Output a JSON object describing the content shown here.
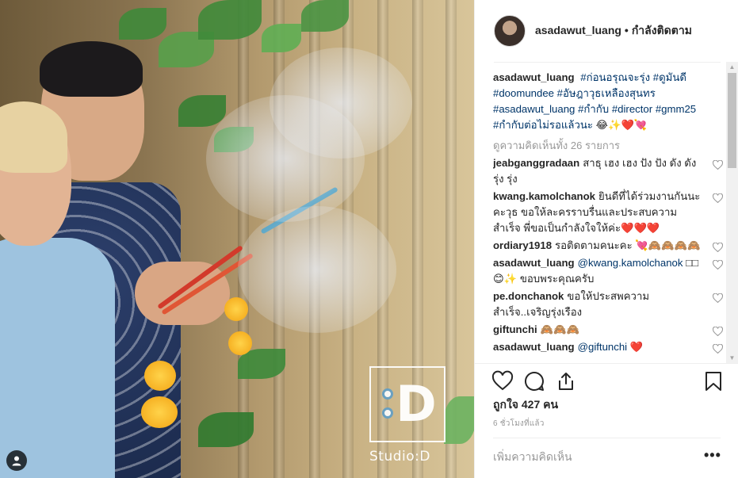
{
  "post": {
    "watermark_text": "Studio:D",
    "watermark_letter": "D"
  },
  "header": {
    "username": "asadawut_luang",
    "separator": "•",
    "follow_label": "กำลังติดตาม"
  },
  "caption": {
    "username": "asadawut_luang",
    "hashtags": [
      "#ก่อนอรุณจะรุ่ง",
      "#ดูมันดี",
      "#doomundee",
      "#อัษฎาวุธเหลืองสุนทร",
      "#asadawut_luang",
      "#กำกับ",
      "#director",
      "#gmm25",
      "#กำกับต่อไม่รอแล้วนะ"
    ],
    "emoji_tail": "😂✨❤️💘"
  },
  "view_all_comments": "ดูความคิดเห็นทั้ง 26 รายการ",
  "comments": [
    {
      "user": "jeabganggradaan",
      "text": "สาธุ เฮง เฮง ปัง ปัง ดัง ดัง รุ่ง รุ่ง"
    },
    {
      "user": "kwang.kamolchanok",
      "text": "ยินดีที่ได้ร่วมงานกันนะคะวุธ ขอให้ละครราบรื่นและประสบความสำเร็จ พี่ขอเป็นกำลังใจให้ค่ะ❤️❤️❤️"
    },
    {
      "user": "ordiary1918",
      "text": "รอติดตามคนะคะ 💘🙈🙈🙈🙈"
    },
    {
      "user": "asadawut_luang",
      "mention": "@kwang.kamolchanok",
      "text": "□□😊✨ ขอบพระคุณครับ"
    },
    {
      "user": "pe.donchanok",
      "text": "ขอให้ประสพความสำเร็จ..เจริญรุ่งเรือง"
    },
    {
      "user": "giftunchi",
      "text": "🙈🙈🙈"
    },
    {
      "user": "asadawut_luang",
      "mention": "@giftunchi",
      "text": "❤️"
    }
  ],
  "actions": {
    "like_icon": "heart-outline",
    "comment_icon": "speech-bubble",
    "share_icon": "share-arrow",
    "save_icon": "bookmark"
  },
  "likes_text": "ถูกใจ 427 คน",
  "timestamp": "6 ชั่วโมงที่แล้ว",
  "add_comment_placeholder": "เพิ่มความคิดเห็น",
  "more_label": "•••"
}
